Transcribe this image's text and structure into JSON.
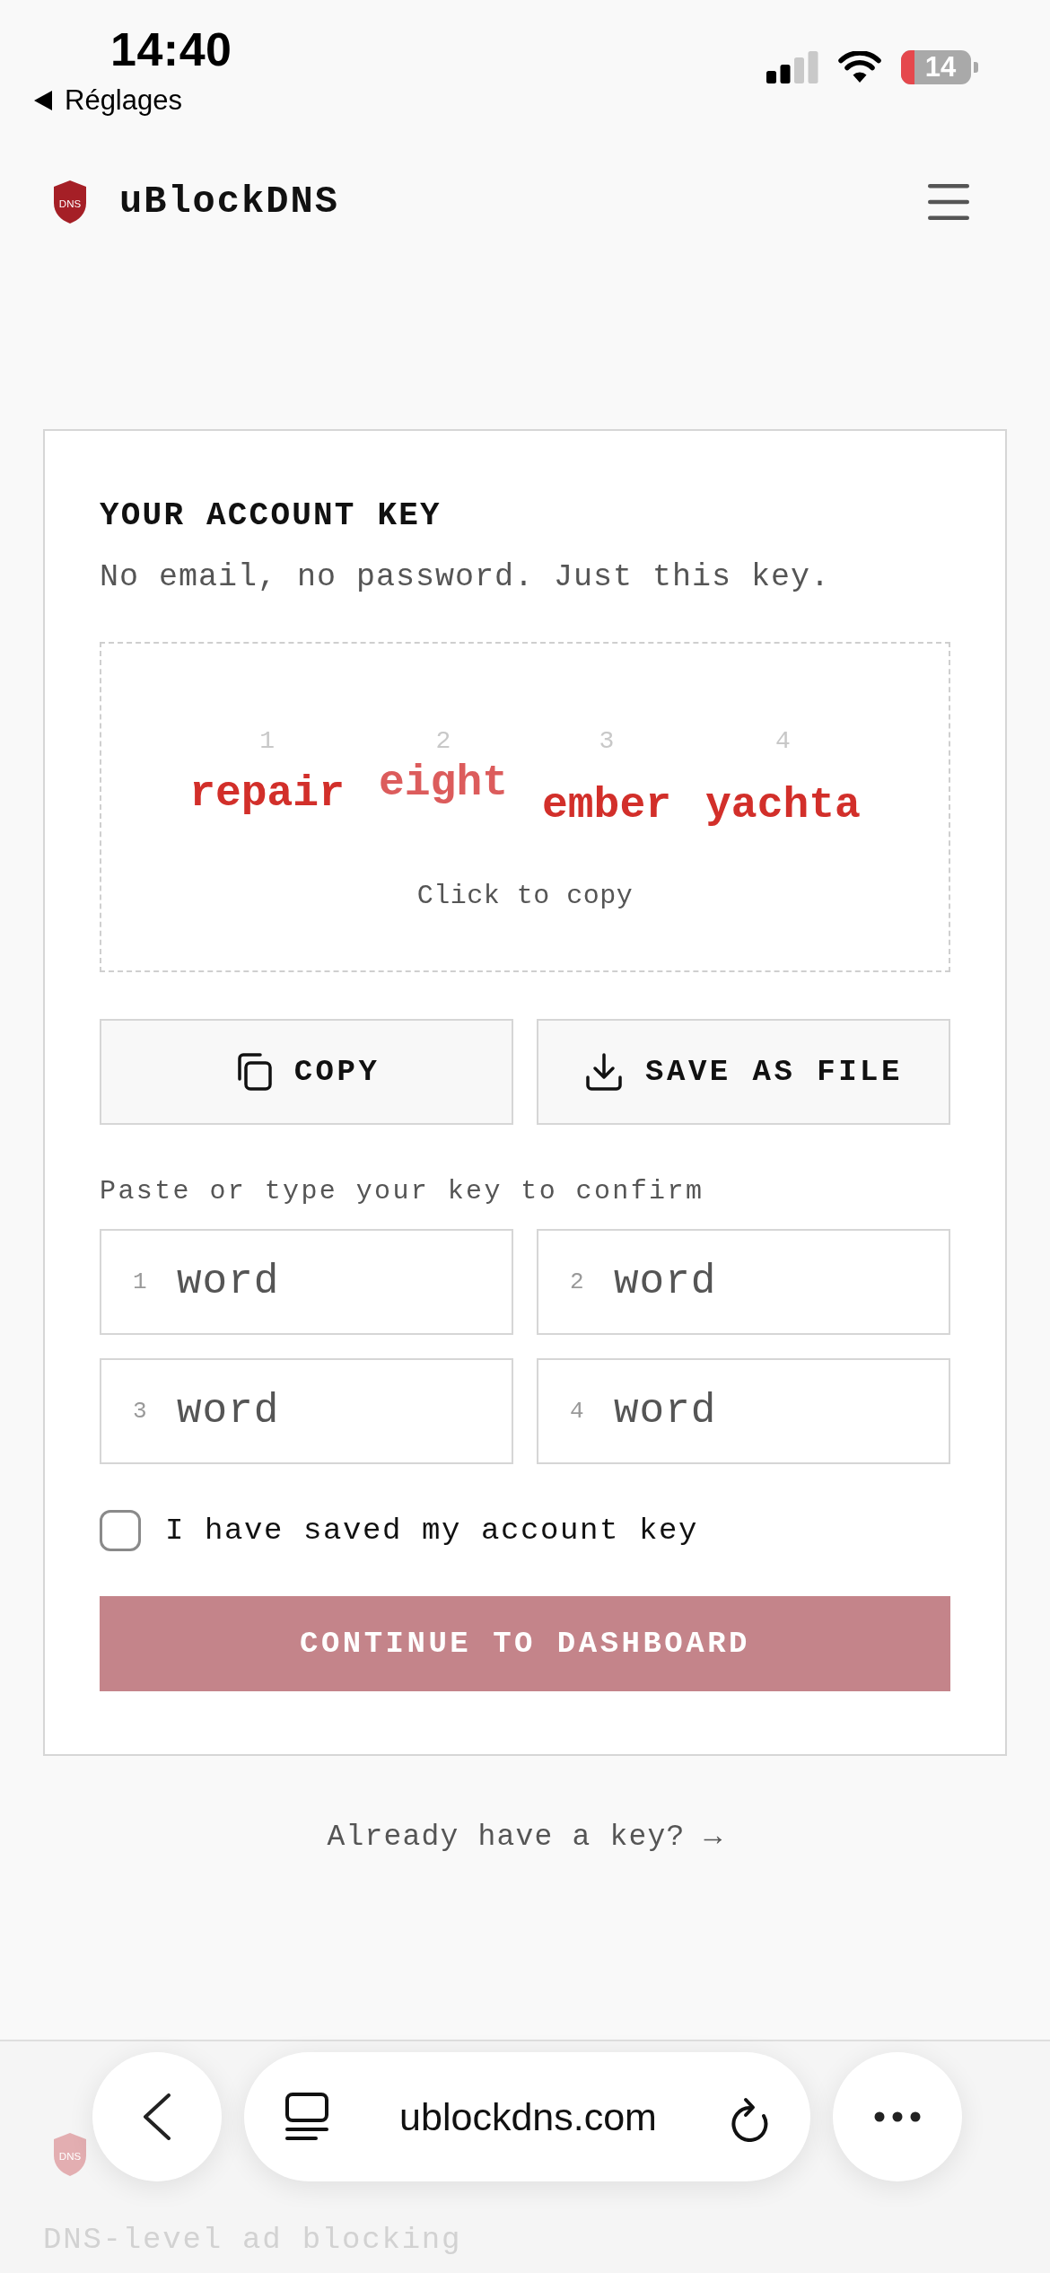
{
  "status_bar": {
    "time": "14:40",
    "back_label": "Réglages",
    "battery": "14"
  },
  "header": {
    "logo_text": "DNS",
    "brand": "uBlockDNS"
  },
  "card": {
    "title": "YOUR ACCOUNT KEY",
    "subtitle": "No email, no password. Just this key.",
    "key_words": [
      {
        "number": "1",
        "word": "repair",
        "color": "#d22f2a"
      },
      {
        "number": "2",
        "word": "eight",
        "color": "#dc5c5c"
      },
      {
        "number": "3",
        "word": "ember",
        "color": "#d22f2a"
      },
      {
        "number": "4",
        "word": "yachta",
        "color": "#d22f2a"
      }
    ],
    "copy_hint": "Click to copy",
    "actions": [
      {
        "kind": "copy",
        "label": "COPY"
      },
      {
        "kind": "download",
        "label": "SAVE AS FILE"
      }
    ],
    "confirm_label": "Paste or type your key to confirm",
    "word_fields": [
      {
        "number": "1",
        "placeholder": "word"
      },
      {
        "number": "2",
        "placeholder": "word"
      },
      {
        "number": "3",
        "placeholder": "word"
      },
      {
        "number": "4",
        "placeholder": "word"
      }
    ],
    "checkbox": {
      "label": "I have saved my account key",
      "checked": false
    },
    "continue_button": {
      "label": "CONTINUE TO DASHBOARD",
      "disabled": true
    }
  },
  "login_link": "Already have a key? →",
  "footer": {
    "logo_text": "DNS",
    "tagline": "DNS-level ad blocking"
  },
  "browser_bar": {
    "url": "ublockdns.com"
  }
}
